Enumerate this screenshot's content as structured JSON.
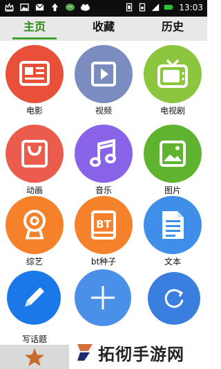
{
  "status_bar": {
    "time": "13:03",
    "left_icons": [
      "crown-icon",
      "image-icon",
      "mail-icon",
      "upload-icon",
      "chat-icon",
      "cloud-icon"
    ],
    "right_icons": [
      "vibrate-icon",
      "sim-icon",
      "signal-icon",
      "battery-icon"
    ]
  },
  "tabs": [
    {
      "label": "主页",
      "active": true
    },
    {
      "label": "收藏",
      "active": false
    },
    {
      "label": "历史",
      "active": false
    }
  ],
  "grid": [
    {
      "label": "电影",
      "icon": "news-icon",
      "color": "#e8503a"
    },
    {
      "label": "视频",
      "icon": "video-icon",
      "color": "#7b8cc0"
    },
    {
      "label": "电视剧",
      "icon": "tv-icon",
      "color": "#8cc63f"
    },
    {
      "label": "动画",
      "icon": "bag-icon",
      "color": "#ec5c4c"
    },
    {
      "label": "音乐",
      "icon": "music-icon",
      "color": "#8a64e8"
    },
    {
      "label": "图片",
      "icon": "picture-icon",
      "color": "#5fb32f"
    },
    {
      "label": "综艺",
      "icon": "train-icon",
      "color": "#f5822a"
    },
    {
      "label": "bt种子",
      "icon": "bt-book-icon",
      "color": "#f5822a"
    },
    {
      "label": "文本",
      "icon": "document-icon",
      "color": "#3f8fe8"
    },
    {
      "label": "写话题",
      "icon": "pencil-icon",
      "color": "#1a78e8"
    },
    {
      "label": "",
      "icon": "plus-icon",
      "color": "#4a8fe8"
    },
    {
      "label": "",
      "icon": "refresh-icon",
      "color": "#3a7ee0"
    }
  ],
  "bottom": {
    "star_color": "#c86a2a",
    "watermark_text": "拓彻手游网"
  }
}
